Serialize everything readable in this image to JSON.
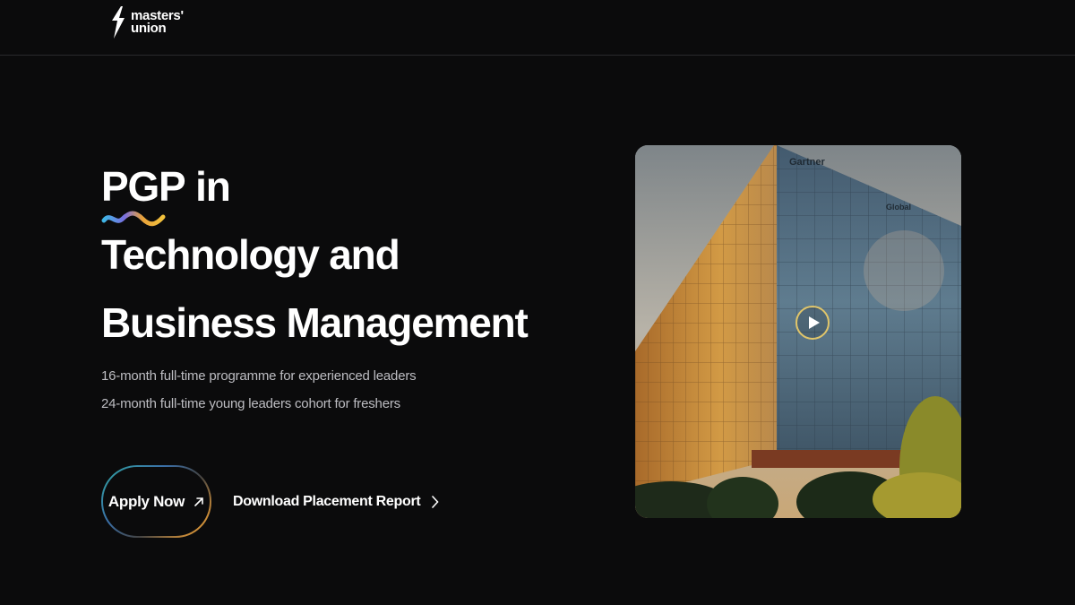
{
  "header": {
    "logo_line1": "masters'",
    "logo_line2": "union"
  },
  "hero": {
    "title_pgp": "PGP",
    "title_in": " in",
    "title_line2": "Technology and",
    "title_line3": "Business Management",
    "subtitle_1": "16-month full-time programme for experienced leaders",
    "subtitle_2": "24-month full-time young leaders cohort for freshers"
  },
  "actions": {
    "apply_label": "Apply Now",
    "download_label": "Download Placement Report"
  },
  "video": {
    "play_icon": "play-icon",
    "building_sign_1": "Gartner",
    "building_sign_2": "Global"
  },
  "colors": {
    "background": "#0b0b0c",
    "text": "#ffffff",
    "subtext": "#bdbdc2",
    "accent_gold": "#e9a23b",
    "accent_teal": "#2fa6a0"
  }
}
